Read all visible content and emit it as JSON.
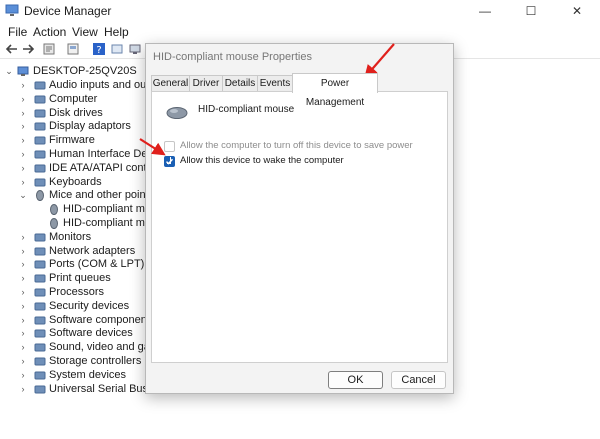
{
  "app": {
    "title": "Device Manager",
    "window_controls": {
      "minimize": "—",
      "maximize": "☐",
      "close": "✕"
    }
  },
  "menus": [
    "File",
    "Action",
    "View",
    "Help"
  ],
  "tree": {
    "root": "DESKTOP-25QV20S",
    "items": [
      "Audio inputs and outpu",
      "Computer",
      "Disk drives",
      "Display adaptors",
      "Firmware",
      "Human Interface Device",
      "IDE ATA/ATAPI controlle",
      "Keyboards",
      "Mice and other pointing",
      "HID-compliant mou",
      "HID-compliant mou",
      "Monitors",
      "Network adapters",
      "Ports (COM & LPT)",
      "Print queues",
      "Processors",
      "Security devices",
      "Software components",
      "Software devices",
      "Sound, video and game",
      "Storage controllers",
      "System devices",
      "Universal Serial Bus cont"
    ]
  },
  "dialog": {
    "title": "HID-compliant mouse Properties",
    "tabs": [
      "General",
      "Driver",
      "Details",
      "Events",
      "Power Management"
    ],
    "active_tab": "Power Management",
    "device_name": "HID-compliant mouse",
    "options": [
      {
        "label": "Allow the computer to turn off this device to save power",
        "checked": false,
        "disabled": true
      },
      {
        "label": "Allow this device to wake the computer",
        "checked": true,
        "disabled": false
      }
    ],
    "ok_label": "OK",
    "cancel_label": "Cancel"
  },
  "colors": {
    "annotation_arrow": "#e0201c",
    "checkbox_accent": "#1a5fb4"
  }
}
